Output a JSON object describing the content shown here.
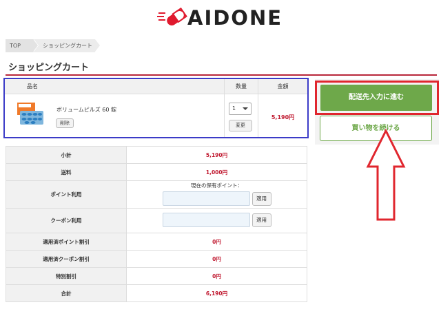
{
  "brand": {
    "logo_text": "AIDONE",
    "logo_color": "#e01a2e"
  },
  "breadcrumb": {
    "items": [
      "TOP",
      "ショッピングカート"
    ]
  },
  "page_title": "ショッピングカート",
  "cart": {
    "headers": {
      "name": "品名",
      "qty": "数量",
      "price": "金額"
    },
    "item": {
      "name": "ボリュームピルズ 60 錠",
      "delete_label": "削除",
      "qty": "1",
      "change_label": "変更",
      "price": "5,190円"
    }
  },
  "actions": {
    "checkout_label": "配送先入力に進む",
    "continue_label": "買い物を続ける",
    "accent_color": "#6ea84a"
  },
  "summary": {
    "subtotal": {
      "label": "小計",
      "value": "5,190円"
    },
    "shipping": {
      "label": "送料",
      "value": "1,000円"
    },
    "points": {
      "label": "ポイント利用",
      "note": "現在の保有ポイント：",
      "apply_label": "適用"
    },
    "coupon": {
      "label": "クーポン利用",
      "apply_label": "適用"
    },
    "applied_points": {
      "label": "適用済ポイント割引",
      "value": "0円"
    },
    "applied_coupon": {
      "label": "適用済クーポン割引",
      "value": "0円"
    },
    "special": {
      "label": "特別割引",
      "value": "0円"
    },
    "total": {
      "label": "合計",
      "value": "6,190円"
    }
  }
}
